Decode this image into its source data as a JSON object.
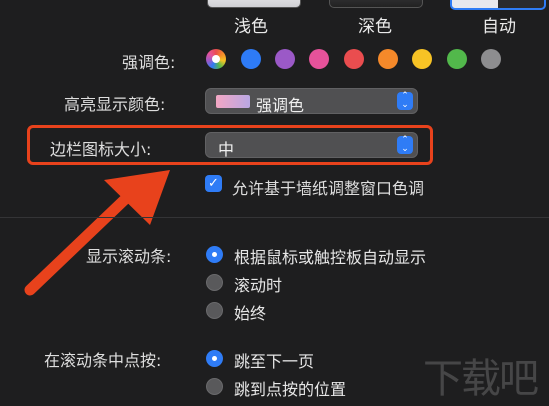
{
  "appearance": {
    "options": [
      "浅色",
      "深色",
      "自动"
    ]
  },
  "accent": {
    "label": "强调色:",
    "colors": [
      "multicolor",
      "#2e7bf6",
      "#9b59c7",
      "#e6529a",
      "#ea4d4f",
      "#f5892a",
      "#f7c325",
      "#52b84b",
      "#8d8d8f"
    ]
  },
  "highlight": {
    "label": "高亮显示颜色:",
    "value": "强调色"
  },
  "sidebar_icon_size": {
    "label": "边栏图标大小:",
    "value": "中"
  },
  "wallpaper_tint": {
    "label": "允许基于墙纸调整窗口色调",
    "checked": true
  },
  "show_scrollbars": {
    "label": "显示滚动条:",
    "options": [
      "根据鼠标或触控板自动显示",
      "滚动时",
      "始终"
    ],
    "selected": 0
  },
  "click_scrollbar": {
    "label": "在滚动条中点按:",
    "options": [
      "跳至下一页",
      "跳到点按的位置"
    ],
    "selected": 0
  },
  "watermark": "下载吧",
  "annotation_color": "#e8421c",
  "accent_blue": "#2f7cf6"
}
